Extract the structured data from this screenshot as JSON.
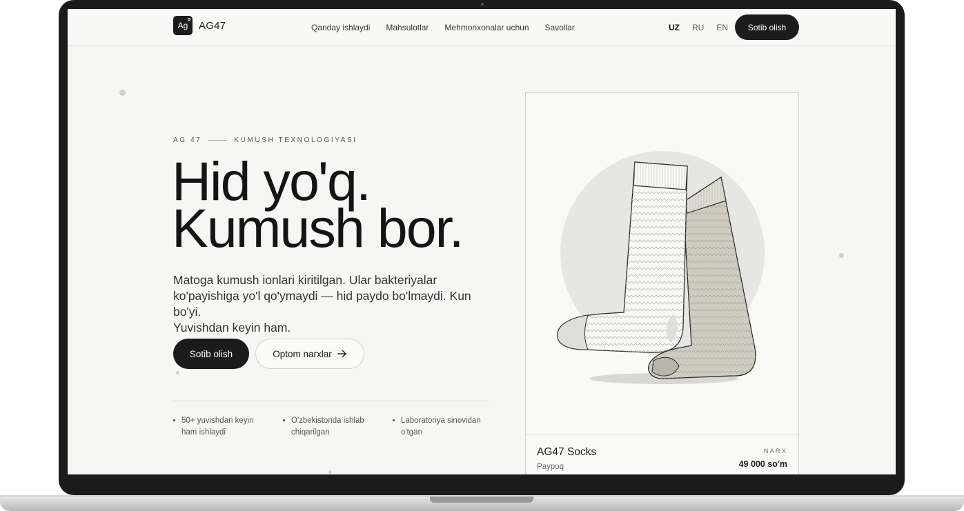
{
  "header": {
    "logo_mark": "Ag",
    "brand": "AG47",
    "nav": [
      "Qanday ishlaydi",
      "Mahsulotlar",
      "Mehmonxonalar uchun",
      "Savollar"
    ],
    "languages": [
      "UZ",
      "RU",
      "EN"
    ],
    "active_language": "UZ",
    "cta_label": "Sotib olish"
  },
  "hero": {
    "eyebrow_left": "AG 47",
    "eyebrow_right": "KUMUSH TEXNOLOGIYASI",
    "headline_line1": "Hid yo'q.",
    "headline_line2": "Kumush bor.",
    "lead_line1": "Matoga kumush ionlari kiritilgan. Ular bakteriyalar",
    "lead_line2": "ko'payishiga yo'l qo'ymaydi — hid paydo bo'lmaydi. Kun bo'yi.",
    "lead_line3": "Yuvishdan keyin ham.",
    "primary_button": "Sotib olish",
    "secondary_button": "Optom narxlar",
    "features": [
      {
        "line1": "50+ yuvishdan keyin",
        "line2": "ham ishlaydi"
      },
      {
        "line1": "O'zbekistonda ishlab",
        "line2": "chiqarilgan"
      },
      {
        "line1": "Laboratoriya sinovidan",
        "line2": "o'tgan"
      }
    ]
  },
  "product_card": {
    "name": "AG47 Socks",
    "subtitle": "Paypoq",
    "price_label": "NARX",
    "price": "49 000 so'm",
    "image": "socks-illustration"
  },
  "colors": {
    "screen_bg": "#f6f6f4",
    "dark": "#1b1b1b",
    "sock_light": "#f7f7f5",
    "sock_beige": "#cfcdc2",
    "circle": "#e6e6e3"
  }
}
